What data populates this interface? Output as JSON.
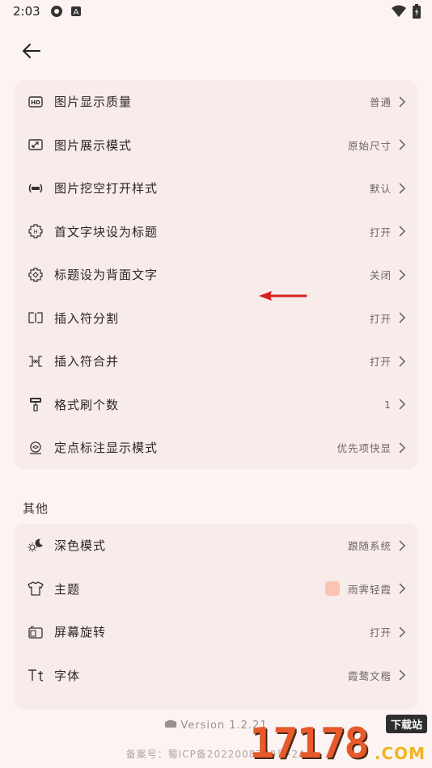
{
  "status_bar": {
    "time": "2:03"
  },
  "settings_group_1": [
    {
      "label": "图片显示质量",
      "value": "普通",
      "icon": "hd-icon"
    },
    {
      "label": "图片展示模式",
      "value": "原始尺寸",
      "icon": "aspect-ratio-icon"
    },
    {
      "label": "图片挖空打开样式",
      "value": "默认",
      "icon": "cloze-icon"
    },
    {
      "label": "首文字块设为标题",
      "value": "打开",
      "icon": "title-block-icon"
    },
    {
      "label": "标题设为背面文字",
      "value": "关闭",
      "icon": "title-back-icon"
    },
    {
      "label": "插入符分割",
      "value": "打开",
      "icon": "split-icon"
    },
    {
      "label": "插入符合并",
      "value": "打开",
      "icon": "merge-icon"
    },
    {
      "label": "格式刷个数",
      "value": "1",
      "icon": "format-brush-icon"
    },
    {
      "label": "定点标注显示模式",
      "value": "优先项快显",
      "icon": "annotation-icon"
    }
  ],
  "section_other": {
    "title": "其他"
  },
  "settings_group_2": [
    {
      "label": "深色模式",
      "value": "跟随系统",
      "icon": "day-night-icon"
    },
    {
      "label": "主题",
      "value": "雨霁轻霞",
      "icon": "shirt-icon",
      "swatch_color": "#fbc3b4"
    },
    {
      "label": "屏幕旋转",
      "value": "打开",
      "icon": "screen-rotate-icon"
    },
    {
      "label": "字体",
      "value": "霞鹜文楷",
      "icon": "font-icon"
    }
  ],
  "footer": {
    "version": "Version 1.2.21",
    "icp": "备案号：蜀ICP备2022008770号-2A"
  },
  "watermark": {
    "number": "17178",
    "tag": "下载站",
    "domain": ".COM"
  },
  "colors": {
    "background": "#fcf4f2",
    "card": "#f7ecea",
    "accent_arrow": "#d62020"
  }
}
